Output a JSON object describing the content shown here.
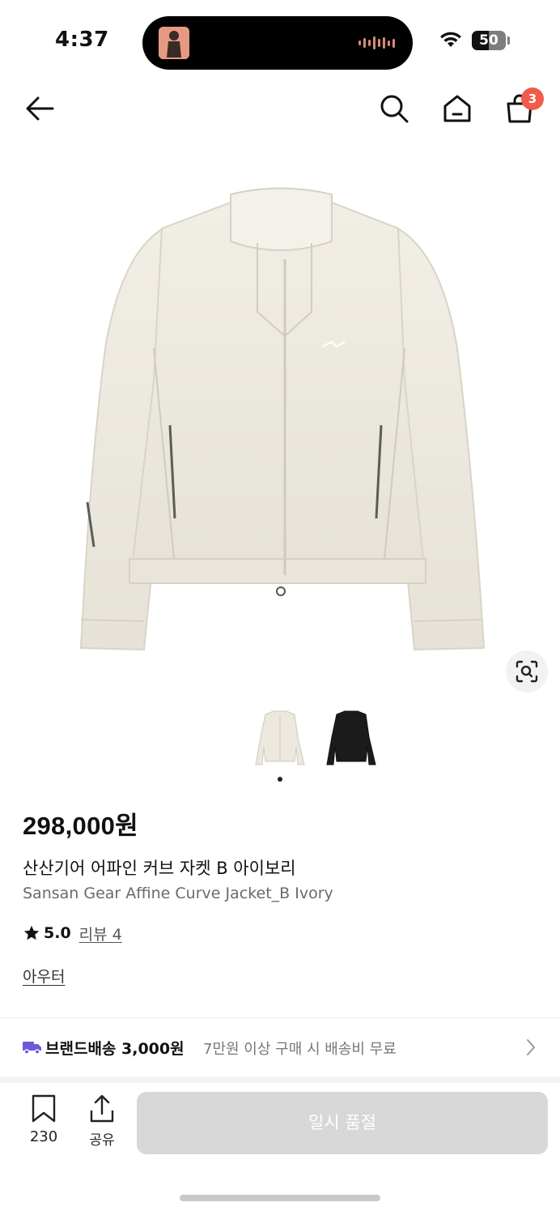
{
  "status_bar": {
    "time": "4:37",
    "battery": "50",
    "battery_level": 0.5
  },
  "header": {
    "cart_count": "3"
  },
  "product": {
    "image_alt": "Ivory jacket",
    "price": "298,000원",
    "name_ko": "산산기어 어파인 커브 자켓 B 아이보리",
    "name_en": "Sansan Gear Affine Curve Jacket_B Ivory",
    "rating": "5.0",
    "review_label": "리뷰 4",
    "category": "아우터",
    "thumbnails": [
      {
        "color": "ivory",
        "selected": true
      },
      {
        "color": "black",
        "selected": false
      }
    ]
  },
  "shipping": {
    "label": "브랜드배송 3,000원",
    "note": "7만원 이상 구매 시 배송비 무료"
  },
  "bottom_bar": {
    "save_count": "230",
    "share_label": "공유",
    "cta_label": "일시 품절"
  },
  "colors": {
    "accent_badge": "#f05b4b",
    "truck_icon": "#6b5bd6",
    "disabled_button": "#d7d7d7",
    "jacket_ivory": "#ece8dd"
  }
}
